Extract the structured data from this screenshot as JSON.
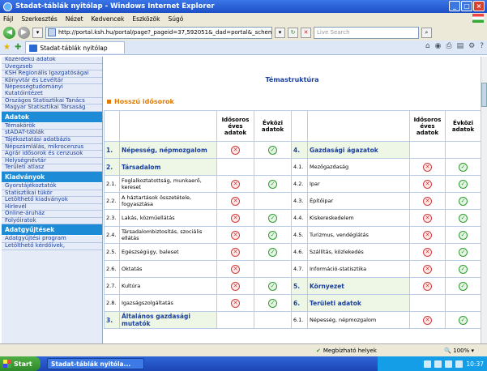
{
  "window": {
    "title": "Stadat-táblák nyitólap - Windows Internet Explorer"
  },
  "menu": [
    "Fájl",
    "Szerkesztés",
    "Nézet",
    "Kedvencek",
    "Eszközök",
    "Súgó"
  ],
  "address": {
    "url": "http://portal.ksh.hu/portal/page?_pageid=37,592051&_dad=portal&_schema=",
    "search_placeholder": "Live Search"
  },
  "tab": {
    "label": "Stadat-táblák nyitólap"
  },
  "sidebar": {
    "top_items": [
      "Közérdekű adatok",
      "Uvegzseb",
      "KSH Regionális Igazgatóságai",
      "Könyvtár és Levéltár",
      "Népességtudományi Kutatóintézet",
      "Országos Statisztikai Tanács",
      "Magyar Statisztikai Társaság"
    ],
    "section1": "Adatok",
    "data_items": [
      "Témakörök",
      "stADAT-táblák",
      "Tájékoztatási adatbázis",
      "Népszámlálás, mikrocenzus",
      "Agrár idősorok és cenzusok",
      "Helységnévtár",
      "Területi atlasz"
    ],
    "section2": "Kiadványok",
    "pub_items": [
      "Gyorstájékoztatók",
      "Statisztikai tükör",
      "Letölthető kiadványok",
      "Hírlevél",
      "Online-áruház",
      "Folyóiratok"
    ],
    "section3": "Adatgyűjtések",
    "coll_items": [
      "Adatgyűjtési program",
      "Letölthető kérdőívek,"
    ]
  },
  "content": {
    "title": "Témastruktúra",
    "subtitle": "Hosszú idősorok",
    "col_annual": "Idősoros éves adatok",
    "col_infra": "Évközi adatok",
    "rows": [
      {
        "ln": "1.",
        "lt": "Népesség, népmozgalom",
        "la": "red",
        "li": "green",
        "lh": true,
        "rn": "4.",
        "rt": "Gazdasági ágazatok",
        "ra": "",
        "ri": "",
        "rh": true
      },
      {
        "ln": "2.",
        "lt": "Társadalom",
        "la": "",
        "li": "",
        "lh": true,
        "rn": "4.1.",
        "rt": "Mezőgazdaság",
        "ra": "red",
        "ri": "green",
        "rh": false
      },
      {
        "ln": "2.1.",
        "lt": "Foglalkoztatottság, munkaerő, kereset",
        "la": "red",
        "li": "green",
        "lh": false,
        "rn": "4.2.",
        "rt": "Ipar",
        "ra": "red",
        "ri": "green",
        "rh": false
      },
      {
        "ln": "2.2.",
        "lt": "A háztartások összetétele, fogyasztása",
        "la": "red",
        "li": "",
        "lh": false,
        "rn": "4.3.",
        "rt": "Építőipar",
        "ra": "red",
        "ri": "green",
        "rh": false
      },
      {
        "ln": "2.3.",
        "lt": "Lakás, közműellátás",
        "la": "red",
        "li": "green",
        "lh": false,
        "rn": "4.4.",
        "rt": "Kiskereskedelem",
        "ra": "red",
        "ri": "green",
        "rh": false
      },
      {
        "ln": "2.4.",
        "lt": "Társadalombiztosítás, szociális ellátás",
        "la": "red",
        "li": "green",
        "lh": false,
        "rn": "4.5.",
        "rt": "Turizmus, vendéglátás",
        "ra": "red",
        "ri": "green",
        "rh": false
      },
      {
        "ln": "2.5.",
        "lt": "Egészségügy, baleset",
        "la": "red",
        "li": "green",
        "lh": false,
        "rn": "4.6.",
        "rt": "Szállítás, közlekedés",
        "ra": "red",
        "ri": "green",
        "rh": false
      },
      {
        "ln": "2.6.",
        "lt": "Oktatás",
        "la": "red",
        "li": "",
        "lh": false,
        "rn": "4.7.",
        "rt": "Információ-statisztika",
        "ra": "red",
        "ri": "green",
        "rh": false
      },
      {
        "ln": "2.7.",
        "lt": "Kultúra",
        "la": "red",
        "li": "green",
        "lh": false,
        "rn": "5.",
        "rt": "Környezet",
        "ra": "red",
        "ri": "green",
        "rh": true
      },
      {
        "ln": "2.8.",
        "lt": "Igazságszolgáltatás",
        "la": "red",
        "li": "green",
        "lh": false,
        "rn": "6.",
        "rt": "Területi adatok",
        "ra": "",
        "ri": "",
        "rh": true
      },
      {
        "ln": "3.",
        "lt": "Általános gazdasági mutatók",
        "la": "",
        "li": "",
        "lh": true,
        "rn": "6.1.",
        "rt": "Népesség, népmozgalom",
        "ra": "red",
        "ri": "green",
        "rh": false
      }
    ]
  },
  "status": {
    "zone": "Megbízható helyek",
    "zoom": "100%"
  },
  "taskbar": {
    "start": "Start",
    "item": "Stadat-táblák nyitóla...",
    "clock": "10:37"
  },
  "colors": {
    "accent": "#1d8bd6",
    "link": "#1a3f9e",
    "subtitle": "#e07b00",
    "red_icon": "#d23c3c",
    "green_icon": "#2f9a2f"
  }
}
